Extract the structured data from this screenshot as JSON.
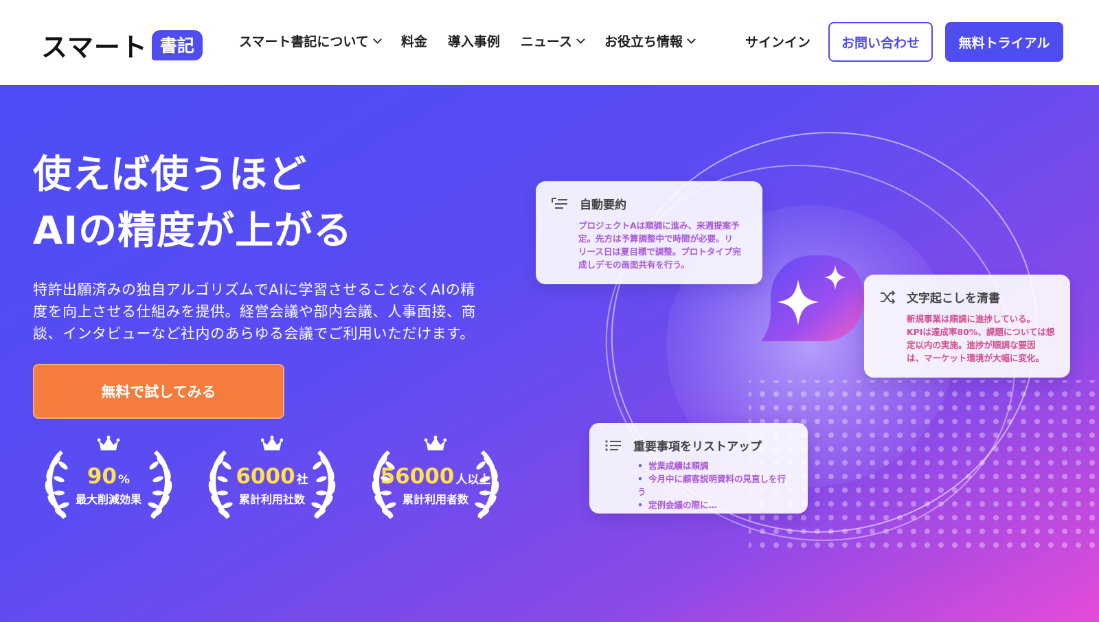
{
  "header": {
    "logo_text": "スマート",
    "logo_badge": "書記",
    "nav": [
      {
        "label": "スマート書記について",
        "dropdown": true
      },
      {
        "label": "料金",
        "dropdown": false
      },
      {
        "label": "導入事例",
        "dropdown": false
      },
      {
        "label": "ニュース",
        "dropdown": true
      },
      {
        "label": "お役立ち情報",
        "dropdown": true
      }
    ],
    "signin": "サインイン",
    "contact": "お問い合わせ",
    "trial": "無料トライアル"
  },
  "hero": {
    "title_line1": "使えば使うほど",
    "title_line2": "AIの精度が上がる",
    "desc_line1": "特許出願済みの独自アルゴリズムでAIに学習させることなくAIの精",
    "desc_line2": "度を向上させる仕組みを提供。経営会議や部内会議、人事面接、商",
    "desc_line3": "談、インタビューなど社内のあらゆる会議でご利用いただけます。",
    "cta": "無料で試してみる",
    "awards": [
      {
        "value": "90",
        "unit": "%",
        "label": "最大削減効果"
      },
      {
        "value": "6000",
        "unit": "社",
        "label": "累計利用社数"
      },
      {
        "value": "56000",
        "unit": "人以上",
        "label": "累計利用者数"
      }
    ]
  },
  "cards": {
    "summary": {
      "title": "自動要約",
      "lines": [
        "プロジェクトAは順調に進み、来週提案予",
        "定。先方は予算調整中で時間が必要。リ",
        "リース日は夏目標で調整。プロトタイプ完",
        "成しデモの画面共有を行う。"
      ]
    },
    "clean": {
      "title": "文字起こしを清書",
      "lines": [
        "新規事業は順調に進捗している。",
        "KPIは達成率80%、課題については想",
        "定以内の実施。進捗が順調な要因",
        "は、マーケット環境が大幅に変化。"
      ]
    },
    "list": {
      "title": "重要事項をリストアップ",
      "items": [
        "営業成績は順調",
        "今月中に顧客説明資料の見直しを行う",
        "定例会議の際に…"
      ]
    }
  },
  "colors": {
    "brand": "#4f4cf0",
    "cta": "#f47c3c",
    "highlight": "#ffe14d"
  }
}
